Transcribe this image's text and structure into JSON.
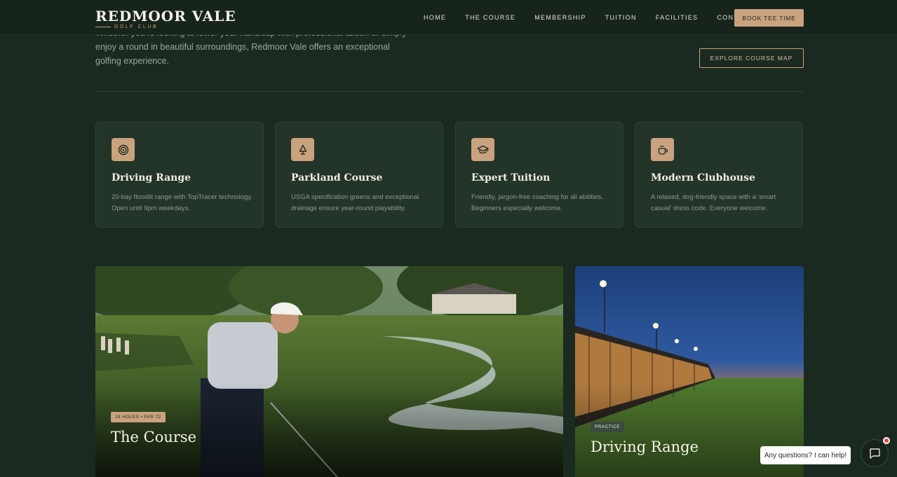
{
  "brand": {
    "name": "REDMOOR VALE",
    "tagline": "GOLF CLUB"
  },
  "nav": {
    "items": [
      "HOME",
      "THE COURSE",
      "MEMBERSHIP",
      "TUITION",
      "FACILITIES",
      "CONTACT"
    ],
    "cta": "BOOK TEE TIME"
  },
  "intro": {
    "text": "Whether you're looking to lower your handicap with professional tuition or simply enjoy a round in beautiful surroundings, Redmoor Vale offers an exceptional golfing experience.",
    "button": "EXPLORE COURSE MAP"
  },
  "features": [
    {
      "icon": "target-icon",
      "title": "Driving Range",
      "desc": "20-bay floodlit range with TopTracer technology. Open until 9pm weekdays."
    },
    {
      "icon": "tree-icon",
      "title": "Parkland Course",
      "desc": "USGA specification greens and exceptional drainage ensure year-round playability."
    },
    {
      "icon": "graduation-cap-icon",
      "title": "Expert Tuition",
      "desc": "Friendly, jargon-free coaching for all abilities. Beginners especially welcome."
    },
    {
      "icon": "coffee-cup-icon",
      "title": "Modern Clubhouse",
      "desc": "A relaxed, dog-friendly space with a 'smart casual' dress code. Everyone welcome."
    }
  ],
  "tiles": [
    {
      "badge": "18 HOLES • PAR 72",
      "title": "The Course"
    },
    {
      "badge": "PRACTICE",
      "title": "Driving Range"
    }
  ],
  "chat": {
    "prompt": "Any questions? I can help!"
  },
  "colors": {
    "background": "#1b2a20",
    "accent": "#c9a27e",
    "card": "#233428",
    "notification": "#e04a3c"
  }
}
